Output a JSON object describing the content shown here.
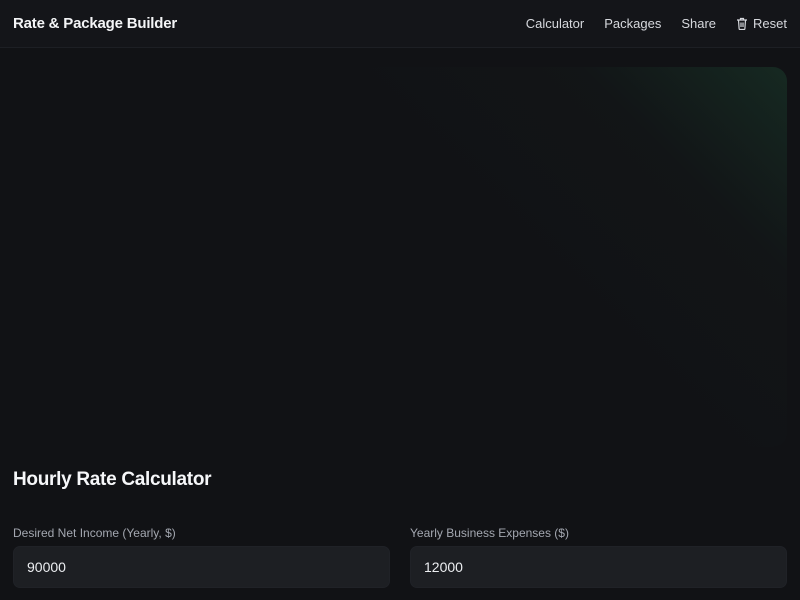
{
  "header": {
    "title": "Rate & Package Builder",
    "nav": {
      "calculator": "Calculator",
      "packages": "Packages",
      "share": "Share",
      "reset": "Reset"
    }
  },
  "calculator": {
    "title": "Hourly Rate Calculator",
    "fields": {
      "net_income": {
        "label": "Desired Net Income (Yearly, $)",
        "value": "90000"
      },
      "expenses": {
        "label": "Yearly Business Expenses ($)",
        "value": "12000"
      }
    }
  },
  "icons": {
    "reset": "trash-icon"
  },
  "colors": {
    "background": "#111215",
    "accent_glow": "#1a3c2c"
  }
}
